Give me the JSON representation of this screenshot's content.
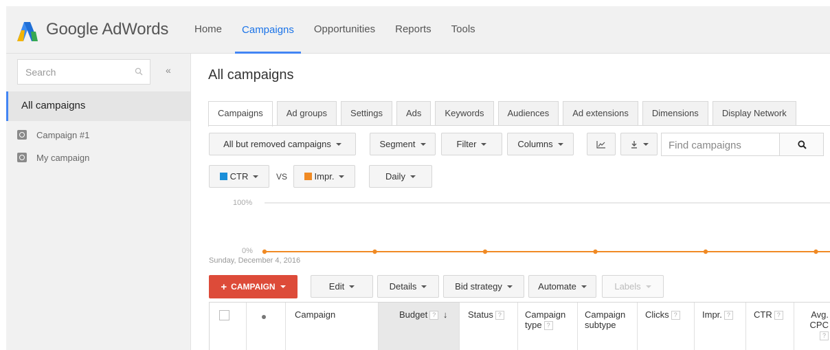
{
  "header": {
    "brand": "Google AdWords",
    "nav": [
      "Home",
      "Campaigns",
      "Opportunities",
      "Reports",
      "Tools"
    ],
    "active_nav": "Campaigns"
  },
  "sidebar": {
    "search_placeholder": "Search",
    "collapse_glyph": "«",
    "all_campaigns": "All campaigns",
    "campaigns": [
      "Campaign #1",
      "My campaign"
    ]
  },
  "main": {
    "title": "All campaigns",
    "tabs": [
      "Campaigns",
      "Ad groups",
      "Settings",
      "Ads",
      "Keywords",
      "Audiences",
      "Ad extensions",
      "Dimensions",
      "Display Network"
    ],
    "active_tab": "Campaigns",
    "toolbar": {
      "filter_status": "All but removed campaigns",
      "segment": "Segment",
      "filter": "Filter",
      "columns": "Columns",
      "find_placeholder": "Find campaigns"
    },
    "chart_controls": {
      "metric1": "CTR",
      "metric1_color": "#1a8ed8",
      "vs": "VS",
      "metric2": "Impr.",
      "metric2_color": "#f08a24",
      "period": "Daily"
    },
    "chart": {
      "top_label": "100%",
      "bottom_label": "0%",
      "date": "Sunday, December 4, 2016"
    },
    "actions": {
      "add_campaign": "CAMPAIGN",
      "edit": "Edit",
      "details": "Details",
      "bid_strategy": "Bid strategy",
      "automate": "Automate",
      "labels": "Labels"
    },
    "table": {
      "columns": {
        "campaign": "Campaign",
        "budget": "Budget",
        "status": "Status",
        "campaign_type": "Campaign type",
        "campaign_type_l1": "Campaign",
        "campaign_type_l2": "type",
        "campaign_subtype_l1": "Campaign",
        "campaign_subtype_l2": "subtype",
        "clicks": "Clicks",
        "impr": "Impr.",
        "ctr": "CTR",
        "avg_cpc_l1": "Avg.",
        "avg_cpc_l2": "CPC"
      },
      "help_glyph": "?",
      "sort_glyph": "↓"
    }
  },
  "chart_data": {
    "type": "line",
    "series": [
      {
        "name": "Impr.",
        "color": "#f08a24",
        "values": [
          0,
          0,
          0,
          0,
          0,
          0,
          0
        ]
      }
    ],
    "ylim": [
      0,
      100
    ],
    "y_ticks": [
      "0%",
      "100%"
    ],
    "x_start_label": "Sunday, December 4, 2016"
  }
}
